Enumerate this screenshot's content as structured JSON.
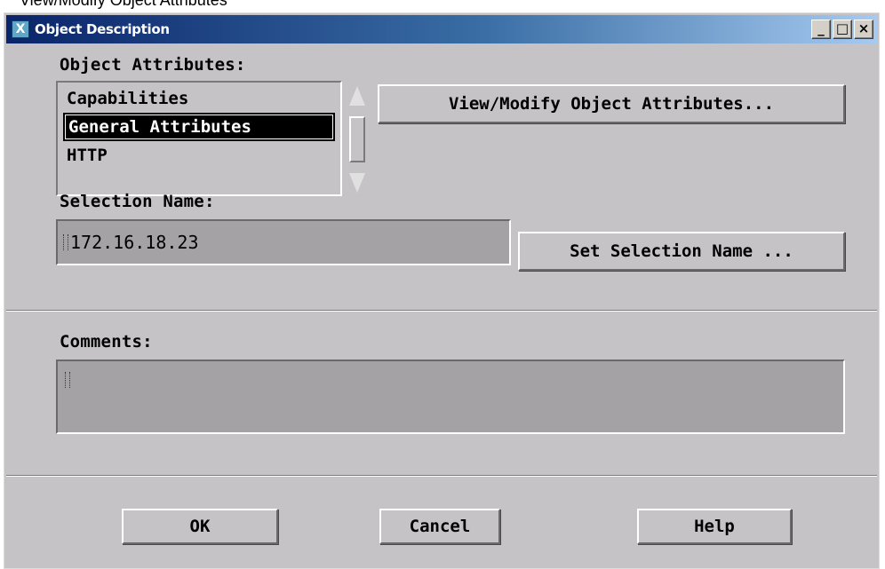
{
  "background_caption": "View/Modify Object Attributes",
  "window": {
    "title": "Object Description",
    "icon_letter": "X",
    "minimize_symbol": "_",
    "maximize_symbol": "□",
    "close_symbol": "×"
  },
  "object_attributes": {
    "label": "Object Attributes:",
    "items": [
      "Capabilities",
      "General Attributes",
      "HTTP"
    ],
    "selected_item": "General Attributes",
    "view_button_label": "View/Modify Object Attributes..."
  },
  "selection": {
    "label": "Selection Name:",
    "value": "172.16.18.23",
    "set_button_label": "Set Selection Name ..."
  },
  "comments": {
    "label": "Comments:",
    "value": ""
  },
  "buttons": {
    "ok_label": "OK",
    "cancel_label": "Cancel",
    "help_label": "Help"
  },
  "icons": {
    "app": "x-window-icon",
    "minimize": "minimize-icon",
    "maximize": "maximize-icon",
    "close": "close-icon",
    "scroll_up": "arrow-up-icon",
    "scroll_down": "arrow-down-icon"
  },
  "colors": {
    "dialog_background": "#c6c3c6",
    "field_background": "#a5a2a5",
    "titlebar_start": "#0a246a",
    "titlebar_end": "#a6caf0"
  }
}
